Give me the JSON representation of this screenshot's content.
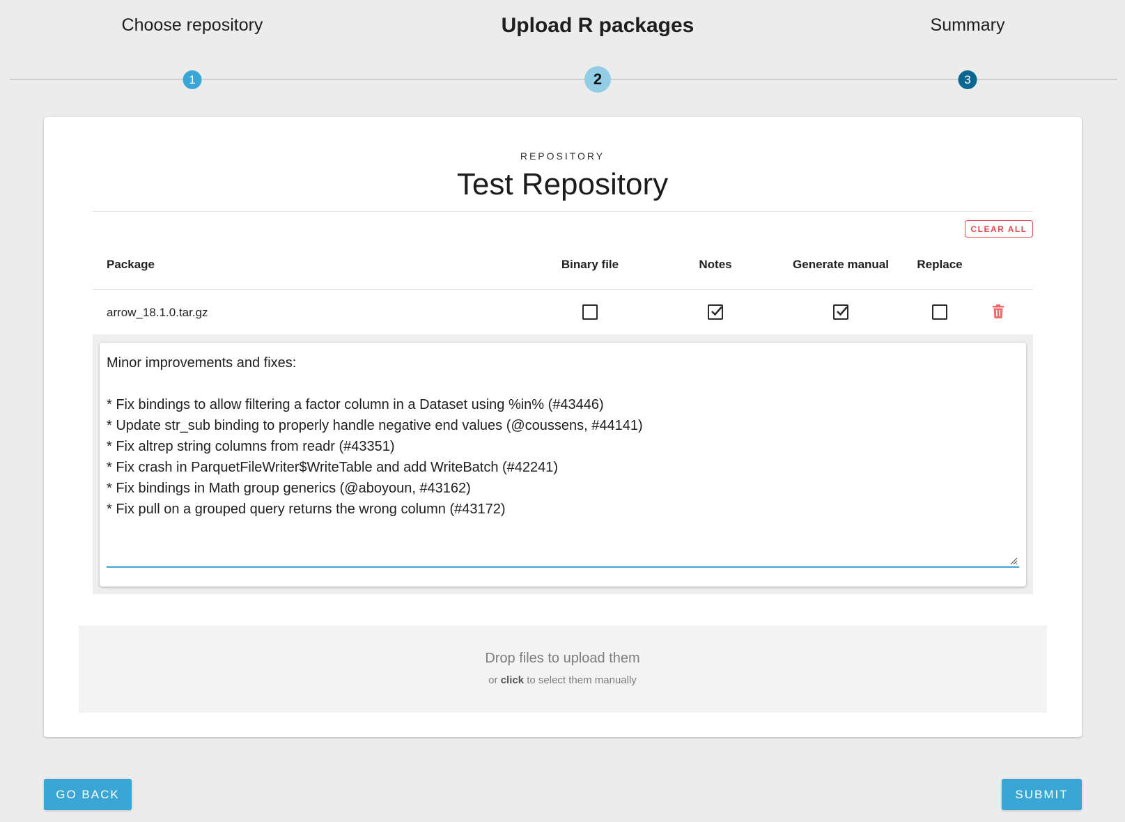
{
  "stepper": {
    "steps": [
      {
        "label": "Choose repository",
        "number": "1"
      },
      {
        "label": "Upload R packages",
        "number": "2"
      },
      {
        "label": "Summary",
        "number": "3"
      }
    ],
    "active_step": 2
  },
  "repository": {
    "caption": "REPOSITORY",
    "name": "Test Repository"
  },
  "table": {
    "clear_all_label": "CLEAR ALL",
    "headers": {
      "package": "Package",
      "binary_file": "Binary file",
      "notes": "Notes",
      "generate_manual": "Generate manual",
      "replace": "Replace"
    },
    "rows": [
      {
        "package": "arrow_18.1.0.tar.gz",
        "binary_file": false,
        "notes": true,
        "generate_manual": true,
        "replace": false
      }
    ]
  },
  "notes": {
    "value": "Minor improvements and fixes:\n\n* Fix bindings to allow filtering a factor column in a Dataset using %in% (#43446)\n* Update str_sub binding to properly handle negative end values (@coussens, #44141)\n* Fix altrep string columns from readr (#43351)\n* Fix crash in ParquetFileWriter$WriteTable and add WriteBatch (#42241)\n* Fix bindings in Math group generics (@aboyoun, #43162)\n* Fix pull on a grouped query returns the wrong column (#43172)"
  },
  "dropzone": {
    "main_text": "Drop files to upload them",
    "sub_prefix": "or ",
    "sub_bold": "click",
    "sub_suffix": " to select them manually"
  },
  "actions": {
    "back_label": "GO BACK",
    "submit_label": "SUBMIT"
  },
  "colors": {
    "accent": "#3aa6d6",
    "step3": "#0a6890",
    "danger": "#e5484d",
    "background": "#edecec"
  }
}
